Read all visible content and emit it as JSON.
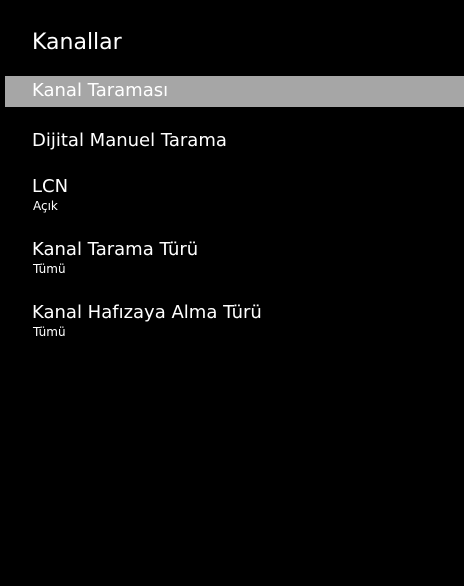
{
  "header": {
    "title": "Kanallar"
  },
  "menu": {
    "items": [
      {
        "label": "Kanal Taraması",
        "selected": true
      },
      {
        "label": "Dijital Manuel Tarama"
      },
      {
        "label": "LCN",
        "value": "Açık"
      },
      {
        "label": "Kanal Tarama Türü",
        "value": "Tümü"
      },
      {
        "label": "Kanal Hafızaya Alma Türü",
        "value": "Tümü"
      }
    ]
  },
  "colors": {
    "background": "#000000",
    "highlight": "#a6a6a6",
    "text": "#ffffff"
  }
}
